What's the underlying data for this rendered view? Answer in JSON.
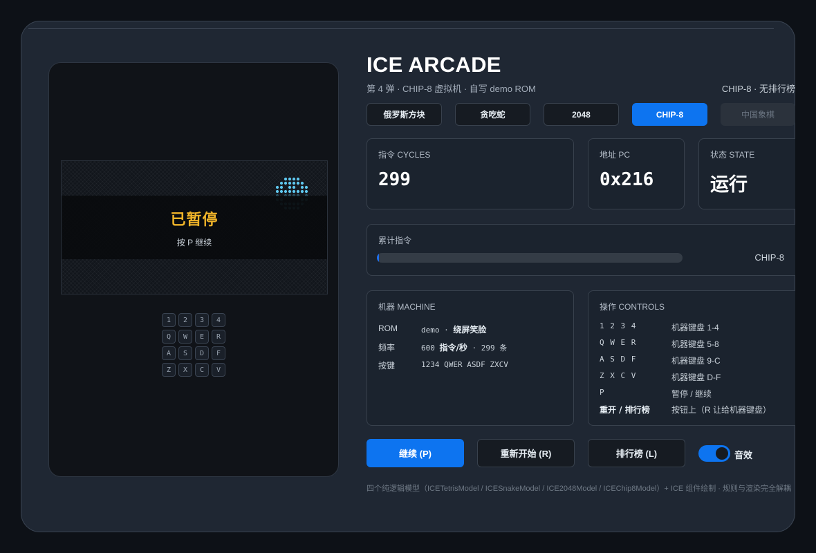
{
  "app": {
    "title": "ICE ARCADE",
    "subtitle": "第 4 弹 · CHIP-8 虚拟机 · 自写 demo ROM",
    "mode": "CHIP-8 · 无排行榜"
  },
  "tabs": [
    {
      "label": "俄罗斯方块",
      "state": "normal"
    },
    {
      "label": "贪吃蛇",
      "state": "normal"
    },
    {
      "label": "2048",
      "state": "normal"
    },
    {
      "label": "CHIP-8",
      "state": "active"
    },
    {
      "label": "中国象棋",
      "state": "disabled"
    }
  ],
  "screen": {
    "pause_title": "已暂停",
    "pause_hint": "按 P 继续",
    "pixel_color": "#5fc8f0",
    "keypad": [
      "1",
      "2",
      "3",
      "4",
      "Q",
      "W",
      "E",
      "R",
      "A",
      "S",
      "D",
      "F",
      "Z",
      "X",
      "C",
      "V"
    ]
  },
  "stats": {
    "cycles_label": "指令 CYCLES",
    "cycles_value": "299",
    "pc_label": "地址 PC",
    "pc_value": "0x216",
    "state_label": "状态 STATE",
    "state_value": "运行"
  },
  "progress": {
    "label": "累计指令",
    "tag": "CHIP-8",
    "fraction": 0.005
  },
  "machine": {
    "title": "机器 MACHINE",
    "rows": [
      {
        "key": "ROM",
        "mono": "demo  · ",
        "bold": "绕屏笑脸",
        "tail": ""
      },
      {
        "key": "频率",
        "mono": "600 ",
        "bold": "指令/秒",
        "tail": " · 299 条"
      },
      {
        "key": "按键",
        "mono": "1234 QWER ASDF ZXCV",
        "bold": "",
        "tail": ""
      }
    ]
  },
  "controls": {
    "title": "操作 CONTROLS",
    "rows": [
      {
        "key": "1 2 3 4",
        "desc": "机器键盘 1-4",
        "bold": false
      },
      {
        "key": "Q W E R",
        "desc": "机器键盘 5-8",
        "bold": false
      },
      {
        "key": "A S D F",
        "desc": "机器键盘 9-C",
        "bold": false
      },
      {
        "key": "Z X C V",
        "desc": "机器键盘 D-F",
        "bold": false
      },
      {
        "key": "P",
        "desc": "暂停 / 继续",
        "bold": false
      },
      {
        "key": "重开 / 排行榜",
        "desc": "按钮上（R 让给机器键盘）",
        "bold": true
      }
    ]
  },
  "buttons": {
    "resume": "继续 (P)",
    "restart": "重新开始 (R)",
    "leaderboard": "排行榜 (L)"
  },
  "sound": {
    "label": "音效",
    "enabled": true
  },
  "footer": "四个纯逻辑模型（ICETetrisModel / ICESnakeModel / ICE2048Model / ICEChip8Model）+ ICE 组件绘制 · 规则与渲染完全解耦"
}
